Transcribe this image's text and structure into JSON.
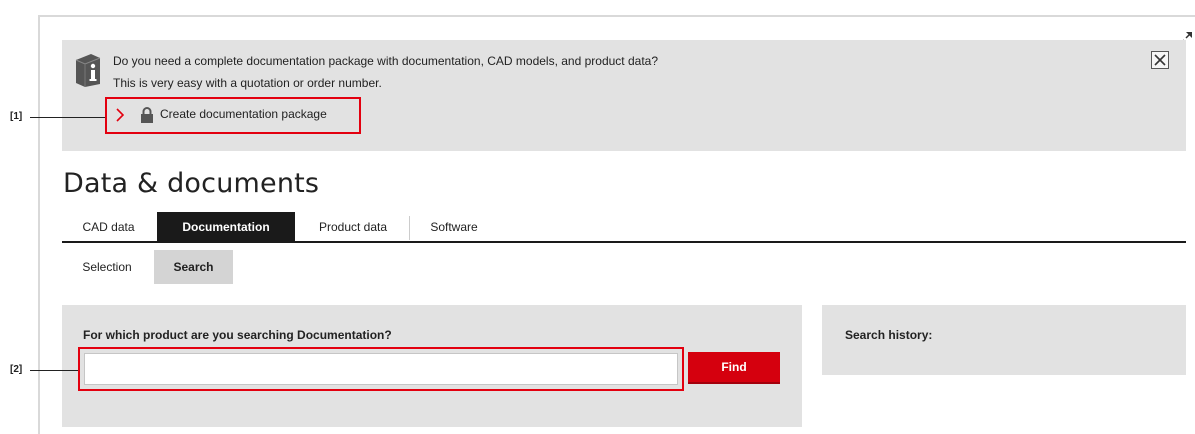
{
  "banner": {
    "line1": "Do you need a complete documentation package with documentation, CAD models, and product data?",
    "line2": "This is very easy with a quotation or order number.",
    "link_label": "Create documentation package",
    "icon": "info-book-icon",
    "close_icon": "close-icon"
  },
  "callouts": {
    "one": "[1]",
    "two": "[2]"
  },
  "page": {
    "title": "Data & documents"
  },
  "tabs": [
    {
      "label": "CAD data",
      "active": false
    },
    {
      "label": "Documentation",
      "active": true
    },
    {
      "label": "Product data",
      "active": false
    },
    {
      "label": "Software",
      "active": false
    }
  ],
  "subtabs": [
    {
      "label": "Selection",
      "active": false
    },
    {
      "label": "Search",
      "active": true
    }
  ],
  "search": {
    "question": "For which product are you searching Documentation?",
    "value": "",
    "find_label": "Find"
  },
  "history": {
    "label": "Search history:"
  },
  "colors": {
    "accent_red": "#e3000f",
    "button_red": "#d5000e",
    "panel_gray": "#e2e2e2",
    "active_tab": "#1a1a1a"
  }
}
